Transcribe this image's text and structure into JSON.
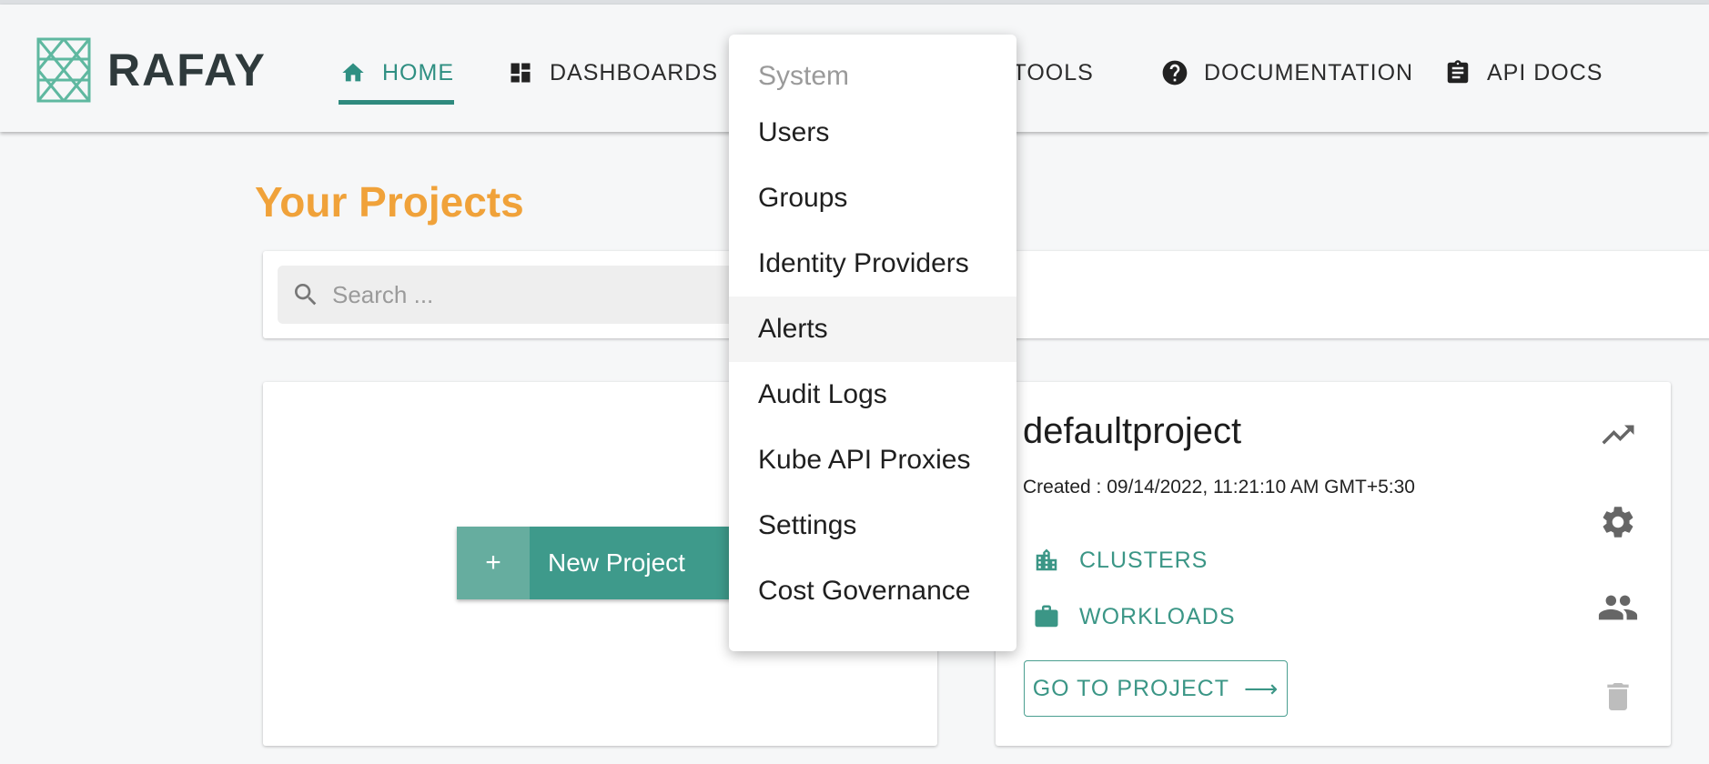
{
  "header": {
    "logo_text": "RAFAY",
    "nav": [
      {
        "label": "HOME",
        "icon": "home-icon",
        "active": true
      },
      {
        "label": "DASHBOARDS",
        "icon": "dashboard-icon"
      },
      {
        "label": "MY TOOLS",
        "icon": ""
      },
      {
        "label": "DOCUMENTATION",
        "icon": "help-circle-icon"
      },
      {
        "label": "API DOCS",
        "icon": "clipboard-icon"
      }
    ]
  },
  "page": {
    "title": "Your Projects",
    "search_placeholder": "Search ..."
  },
  "new_project": {
    "plus": "+",
    "label": "New Project"
  },
  "project": {
    "name": "defaultproject",
    "created": "Created : 09/14/2022, 11:21:10 AM GMT+5:30",
    "clusters_label": "CLUSTERS",
    "workloads_label": "WORKLOADS",
    "goto_label": "GO TO PROJECT",
    "goto_arrow": "⟶"
  },
  "system_menu": {
    "header": "System",
    "items": [
      "Users",
      "Groups",
      "Identity Providers",
      "Alerts",
      "Audit Logs",
      "Kube API Proxies",
      "Settings",
      "Cost Governance"
    ],
    "highlighted": "Alerts"
  },
  "colors": {
    "accent": "#2f8a7e",
    "title_orange": "#f0a23a",
    "logo_teal": "#5fb8a0"
  }
}
